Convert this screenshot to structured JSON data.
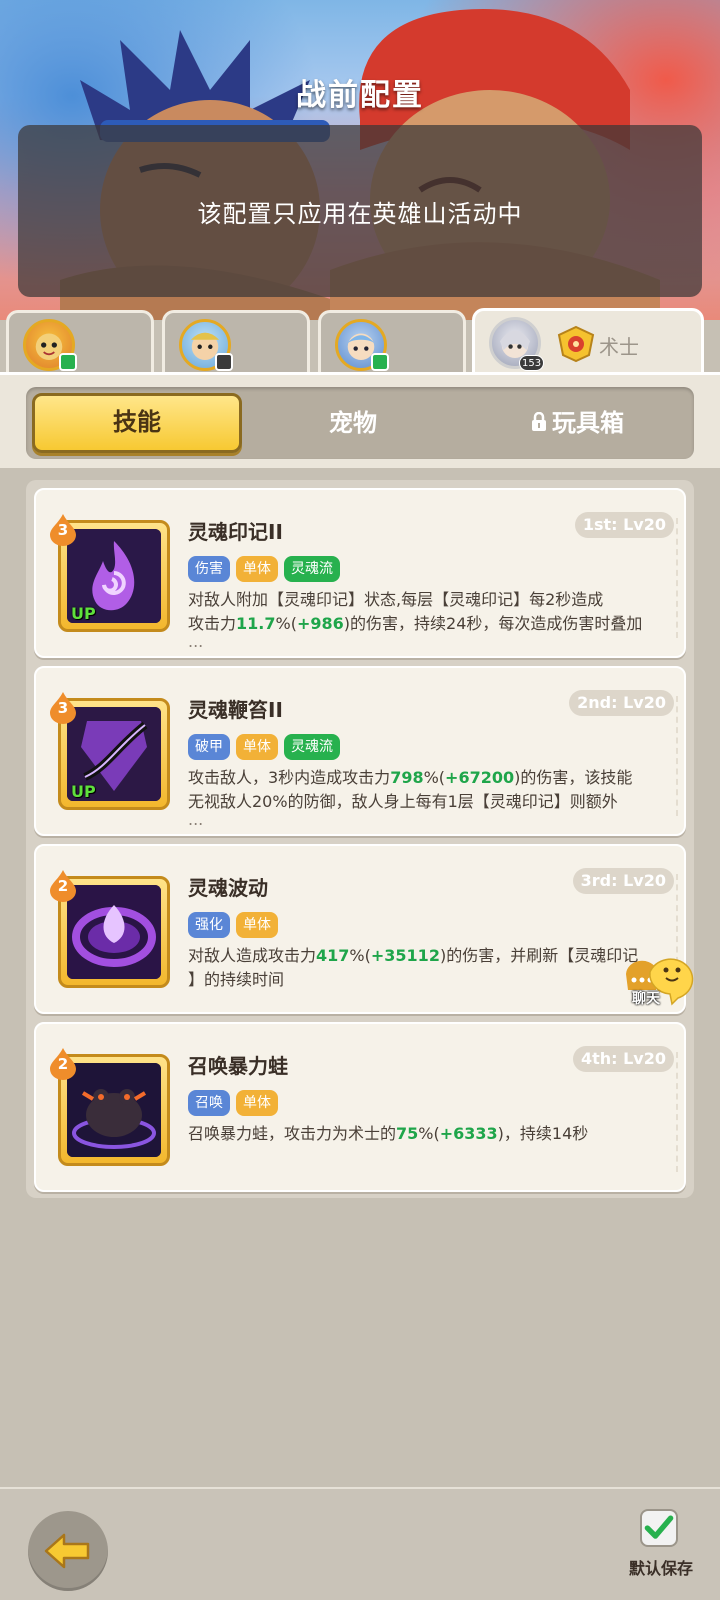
{
  "header": {
    "title": "战前配置",
    "notice": "该配置只应用在英雄山活动中"
  },
  "hero_tabs": [
    {
      "active": false,
      "badge": "green"
    },
    {
      "active": false,
      "badge": "dark"
    },
    {
      "active": false,
      "badge": "green"
    },
    {
      "active": true,
      "level": "153",
      "class_label": "术士"
    }
  ],
  "segments": {
    "skills": "技能",
    "pets": "宠物",
    "toybox": "玩具箱"
  },
  "skills": [
    {
      "name": "灵魂印记II",
      "slot": "1st: Lv20",
      "level": "3",
      "up": "UP",
      "tags": [
        "伤害",
        "单体",
        "灵魂流"
      ],
      "desc_1": "对敌人附加【灵魂印记】状态,每层【灵魂印记】每2秒造成",
      "desc_2a": "攻击力",
      "desc_2b": "11.7",
      "desc_2c": "%(",
      "desc_2d": "+986",
      "desc_2e": ")的伤害，持续24秒，每次造成伤害时叠加",
      "ellipsis": "..."
    },
    {
      "name": "灵魂鞭笞II",
      "slot": "2nd: Lv20",
      "level": "3",
      "up": "UP",
      "tags": [
        "破甲",
        "单体",
        "灵魂流"
      ],
      "desc_1a": "攻击敌人，3秒内造成攻击力",
      "desc_1b": "798",
      "desc_1c": "%(",
      "desc_1d": "+67200",
      "desc_1e": ")的伤害，该技能",
      "desc_2": "无视敌人20%的防御，敌人身上每有1层【灵魂印记】则额外",
      "ellipsis": "..."
    },
    {
      "name": "灵魂波动",
      "slot": "3rd: Lv20",
      "level": "2",
      "tags": [
        "强化",
        "单体"
      ],
      "desc_1a": "对敌人造成攻击力",
      "desc_1b": "417",
      "desc_1c": "%(",
      "desc_1d": "+35112",
      "desc_1e": ")的伤害，并刷新【灵魂印记",
      "desc_2": "】的持续时间"
    },
    {
      "name": "召唤暴力蛙",
      "slot": "4th: Lv20",
      "level": "2",
      "tags": [
        "召唤",
        "单体"
      ],
      "desc_1a": "召唤暴力蛙，攻击力为术士的",
      "desc_1b": "75",
      "desc_1c": "%(",
      "desc_1d": "+6333",
      "desc_1e": ")，持续14秒"
    }
  ],
  "chat": {
    "label": "聊天"
  },
  "footer": {
    "save_label": "默认保存"
  }
}
